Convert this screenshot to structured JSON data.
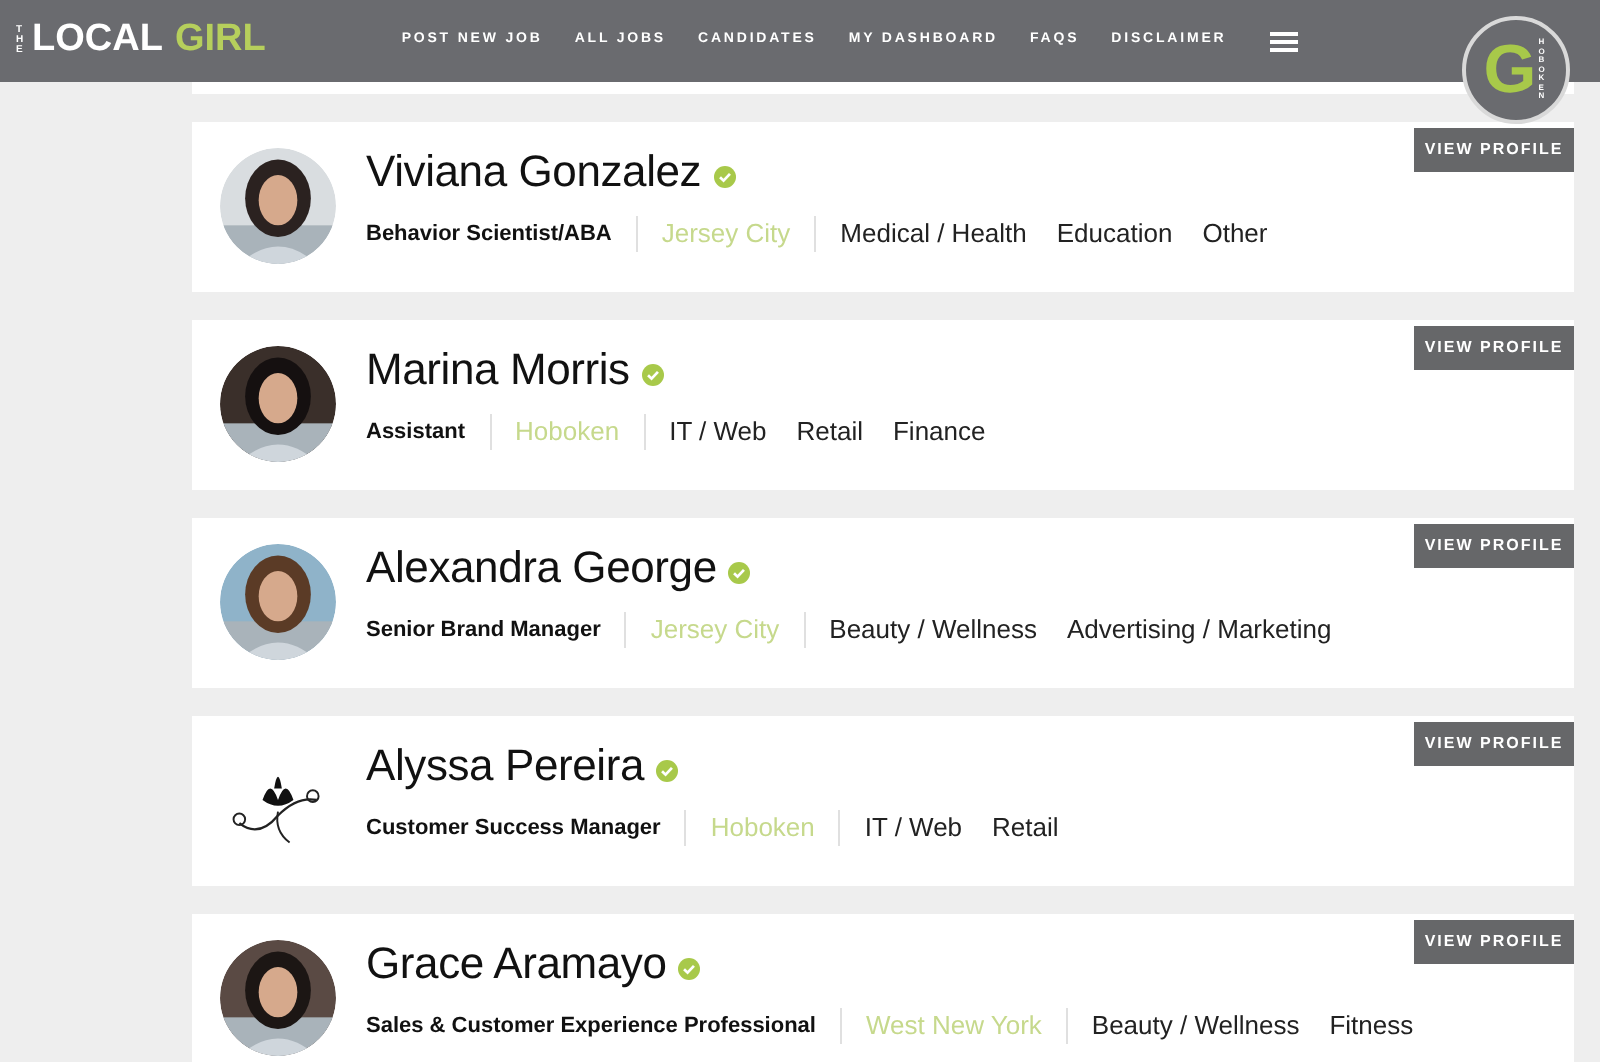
{
  "header": {
    "logo": {
      "prefix": "THE",
      "word1": "LOCAL",
      "word2": "GIRL"
    },
    "nav": [
      "POST NEW JOB",
      "ALL JOBS",
      "CANDIDATES",
      "MY DASHBOARD",
      "FAQS",
      "DISCLAIMER"
    ],
    "badge": {
      "letter": "G",
      "text": "HOBOKEN"
    }
  },
  "candidates": [
    {
      "name": "Viviana Gonzalez",
      "verified": true,
      "title": "Behavior Scientist/ABA",
      "location": "Jersey City",
      "categories": [
        "Medical / Health",
        "Education",
        "Other"
      ],
      "button": "VIEW PROFILE"
    },
    {
      "name": "Marina Morris",
      "verified": true,
      "title": "Assistant",
      "location": "Hoboken",
      "categories": [
        "IT / Web",
        "Retail",
        "Finance"
      ],
      "button": "VIEW PROFILE"
    },
    {
      "name": "Alexandra George",
      "verified": true,
      "title": "Senior Brand Manager",
      "location": "Jersey City",
      "categories": [
        "Beauty / Wellness",
        "Advertising / Marketing"
      ],
      "button": "VIEW PROFILE"
    },
    {
      "name": "Alyssa Pereira",
      "verified": true,
      "title": "Customer Success Manager",
      "location": "Hoboken",
      "categories": [
        "IT / Web",
        "Retail"
      ],
      "button": "VIEW PROFILE"
    },
    {
      "name": "Grace Aramayo",
      "verified": true,
      "title": "Sales & Customer Experience Professional",
      "location": "West New York",
      "categories": [
        "Beauty / Wellness",
        "Fitness"
      ],
      "button": "VIEW PROFILE"
    }
  ]
}
